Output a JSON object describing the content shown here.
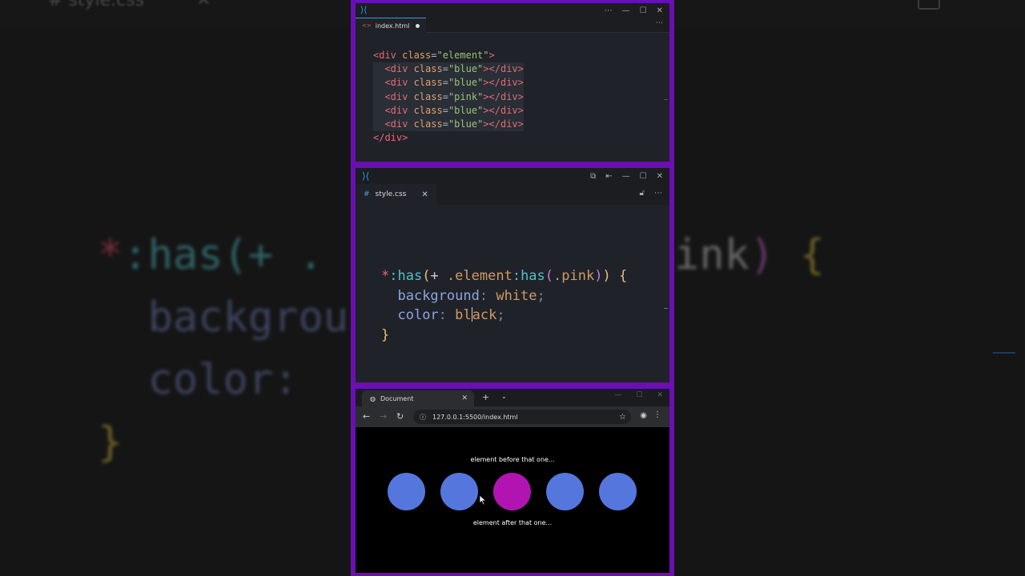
{
  "background": {
    "tab_left": "# style.css",
    "tab_close": "✕",
    "code_line1_a": "*",
    "code_line1_b": ":has(+ .",
    "code_line1_c": ".pink",
    "code_line1_d": ")",
    "code_line1_e": "{",
    "code_line2": "backgrou",
    "code_line3": "color:",
    "code_line4": "}"
  },
  "html_editor": {
    "tab_label": "index.html",
    "code": [
      {
        "indent": "",
        "open": "<div ",
        "attr": "class",
        "eq": "=",
        "val": "\"element\"",
        "close": ">",
        "end": ""
      },
      {
        "indent": "  ",
        "open": "<div ",
        "attr": "class",
        "eq": "=",
        "val": "\"blue\"",
        "close": "></",
        "end": "div>"
      },
      {
        "indent": "  ",
        "open": "<div ",
        "attr": "class",
        "eq": "=",
        "val": "\"blue\"",
        "close": "></",
        "end": "div>"
      },
      {
        "indent": "  ",
        "open": "<div ",
        "attr": "class",
        "eq": "=",
        "val": "\"pink\"",
        "close": "></",
        "end": "div>"
      },
      {
        "indent": "  ",
        "open": "<div ",
        "attr": "class",
        "eq": "=",
        "val": "\"blue\"",
        "close": "></",
        "end": "div>"
      },
      {
        "indent": "  ",
        "open": "<div ",
        "attr": "class",
        "eq": "=",
        "val": "\"blue\"",
        "close": "></",
        "end": "div>"
      },
      {
        "indent": "",
        "open": "</div>",
        "attr": "",
        "eq": "",
        "val": "",
        "close": "",
        "end": ""
      }
    ]
  },
  "css_editor": {
    "tab_label": "style.css",
    "code": {
      "l1_star": "*",
      "l1_has": ":has",
      "l1_paren": "(",
      "l1_plus": "+ ",
      "l1_sel": ".element",
      "l1_has2": ":has",
      "l1_paren2": "(",
      "l1_pink": ".pink",
      "l1_close2": ")",
      "l1_close": ")",
      "l1_brace": " {",
      "l2_prop": "background",
      "l2_colon": ": ",
      "l2_val": "white",
      "l2_semi": ";",
      "l3_prop": "color",
      "l3_colon": ": ",
      "l3_val_a": "bl",
      "l3_val_b": "ack",
      "l3_semi": ";",
      "l4_brace": "}"
    }
  },
  "browser": {
    "tab_title": "Document",
    "url": "127.0.0.1:5500/index.html",
    "label_before": "element before that one...",
    "label_after": "element after that one...",
    "circles": [
      {
        "color": "#5577dd"
      },
      {
        "color": "#5577dd"
      },
      {
        "color": "#b214b2"
      },
      {
        "color": "#5577dd"
      },
      {
        "color": "#5577dd"
      }
    ]
  },
  "colors": {
    "frame": "#6a0fb0",
    "blue_circle": "#5577dd",
    "pink_circle": "#b214b2",
    "accent": "#2f9de8"
  },
  "icons": {
    "vscode": "vscode-logo-icon",
    "html_file": "html-file-icon",
    "css_file": "css-hash-icon",
    "minimize": "minimize-icon",
    "maximize": "maximize-icon",
    "close": "close-icon",
    "more": "more-icon",
    "lock": "lock-icon",
    "back": "back-arrow-icon",
    "forward": "forward-arrow-icon",
    "reload": "reload-icon",
    "info": "info-icon",
    "bookmark": "star-icon",
    "profile": "profile-icon",
    "menu": "kebab-menu-icon"
  }
}
